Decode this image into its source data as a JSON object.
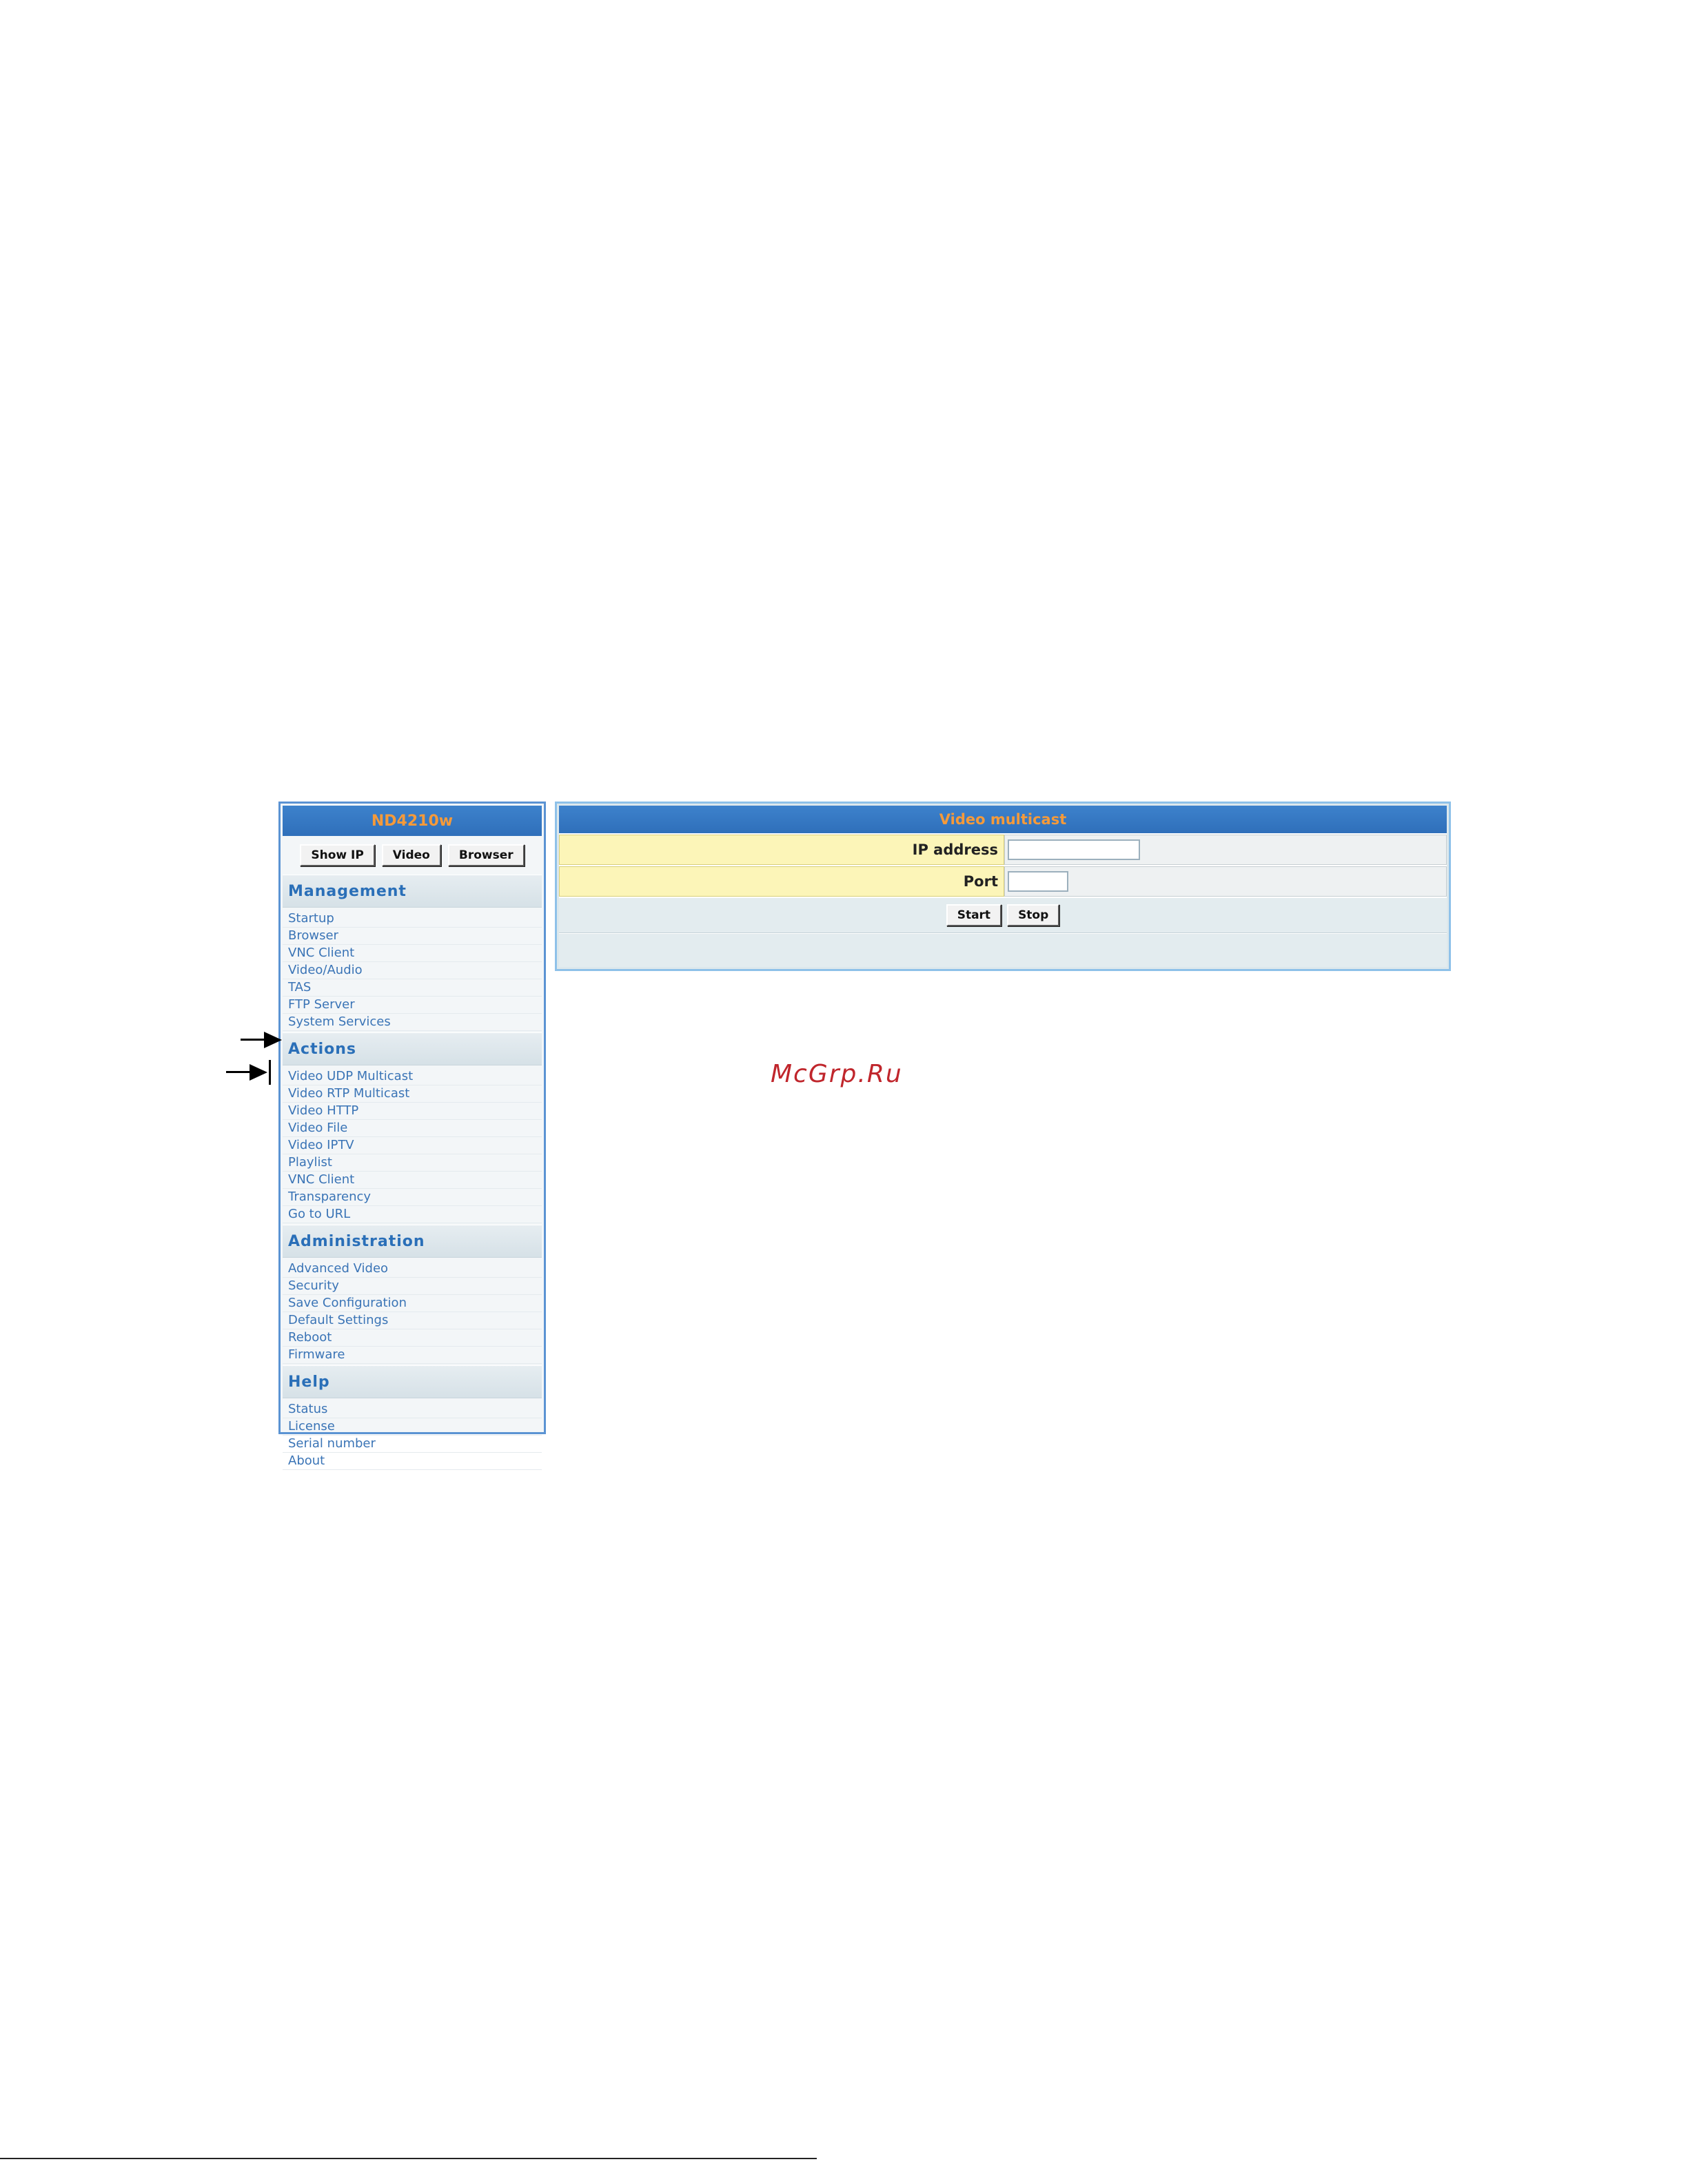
{
  "sidebar": {
    "title": "ND4210w",
    "buttons": [
      "Show IP",
      "Video",
      "Browser"
    ],
    "sections": [
      {
        "title": "Management",
        "items": [
          "Startup",
          "Browser",
          "VNC Client",
          "Video/Audio",
          "TAS",
          "FTP Server",
          "System Services"
        ]
      },
      {
        "title": "Actions",
        "items": [
          "Video UDP Multicast",
          "Video RTP Multicast",
          "Video HTTP",
          "Video File",
          "Video IPTV",
          "Playlist",
          "VNC Client",
          "Transparency",
          "Go to URL"
        ]
      },
      {
        "title": "Administration",
        "items": [
          "Advanced Video",
          "Security",
          "Save Configuration",
          "Default Settings",
          "Reboot",
          "Firmware"
        ]
      },
      {
        "title": "Help",
        "items": [
          "Status",
          "License",
          "Serial number",
          "About"
        ]
      }
    ]
  },
  "main": {
    "title": "Video multicast",
    "fields": [
      {
        "label": "IP address",
        "value": ""
      },
      {
        "label": "Port",
        "value": ""
      }
    ],
    "start_label": "Start",
    "stop_label": "Stop"
  },
  "watermark": "McGrp.Ru",
  "footer_mark": "  "
}
